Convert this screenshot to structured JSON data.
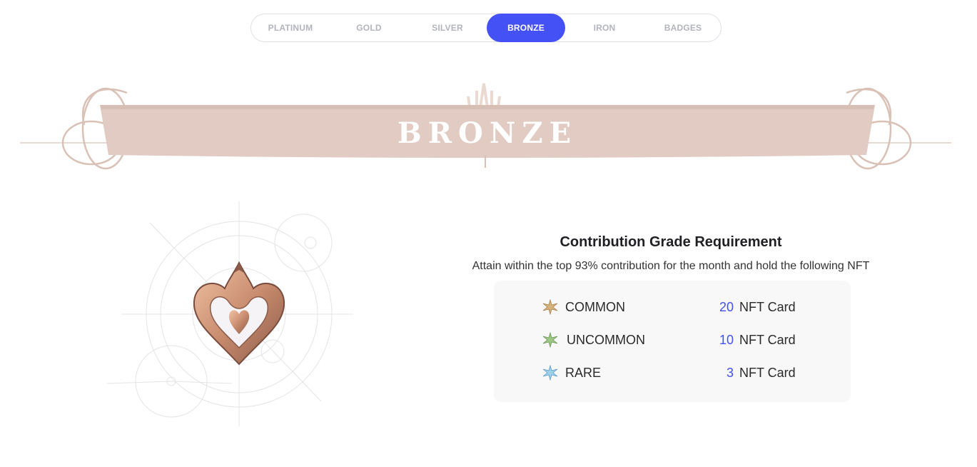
{
  "tabs": [
    {
      "label": "PLATINUM",
      "active": false
    },
    {
      "label": "GOLD",
      "active": false
    },
    {
      "label": "SILVER",
      "active": false
    },
    {
      "label": "BRONZE",
      "active": true
    },
    {
      "label": "IRON",
      "active": false
    },
    {
      "label": "BADGES",
      "active": false
    }
  ],
  "banner": {
    "title": "BRONZE"
  },
  "requirement": {
    "title": "Contribution Grade Requirement",
    "subtitle": "Attain within the top 93% contribution for the month and hold the following NFT",
    "items": [
      {
        "gem_icon": "star-gem-gold-icon",
        "rarity": "COMMON",
        "quantity": "20",
        "unit": "NFT Card"
      },
      {
        "gem_icon": "star-gem-green-icon",
        "rarity": "UNCOMMON",
        "quantity": "10",
        "unit": "NFT Card"
      },
      {
        "gem_icon": "star-gem-blue-icon",
        "rarity": "RARE",
        "quantity": "3",
        "unit": "NFT Card"
      }
    ]
  },
  "colors": {
    "accent": "#4351f5",
    "banner": "#e1cbc3",
    "bronze": "#c98d6f"
  }
}
